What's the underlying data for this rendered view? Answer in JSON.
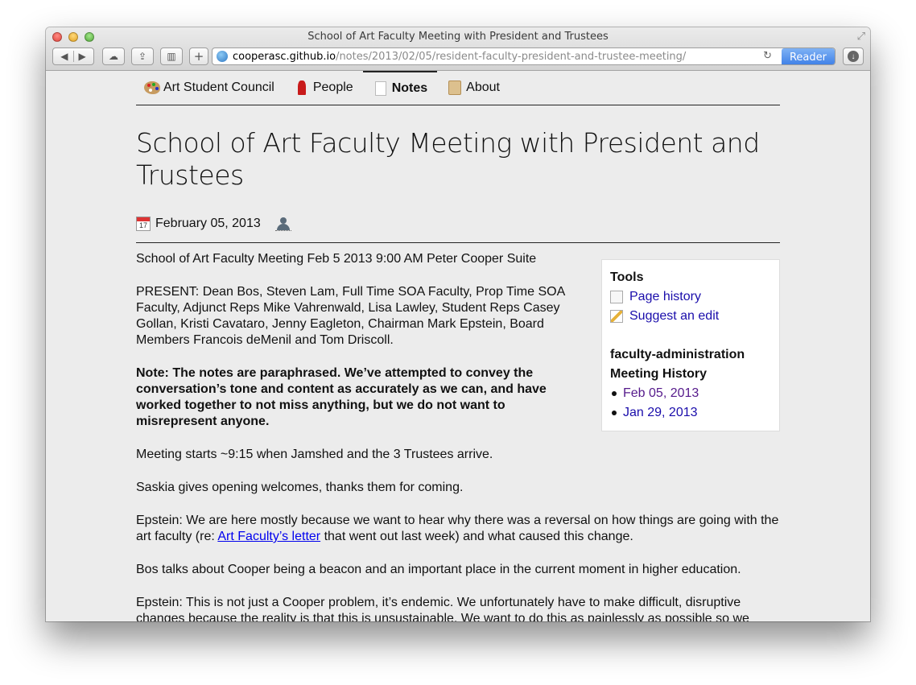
{
  "window": {
    "title": "School of Art Faculty Meeting with President and Trustees",
    "url_host": "cooperasc.github.io",
    "url_path": "/notes/2013/02/05/resident-faculty-president-and-trustee-meeting/",
    "reader_label": "Reader"
  },
  "nav": {
    "items": [
      {
        "label": "Art Student Council",
        "icon": "palette-icon"
      },
      {
        "label": "People",
        "icon": "dancer-icon"
      },
      {
        "label": "Notes",
        "icon": "document-icon",
        "active": true
      },
      {
        "label": "About",
        "icon": "scroll-icon"
      }
    ]
  },
  "post": {
    "title": "School of Art Faculty Meeting with President and Trustees",
    "date": "February 05, 2013",
    "calendar_day": "17",
    "paragraphs": {
      "p1": "School of Art Faculty Meeting Feb 5 2013 9:00 AM Peter Cooper Suite",
      "p2": "PRESENT: Dean Bos, Steven Lam, Full Time SOA Faculty, Prop Time SOA Faculty, Adjunct Reps Mike Vahrenwald, Lisa Lawley, Student Reps Casey Gollan, Kristi Cavataro, Jenny Eagleton, Chairman Mark Epstein, Board Members Francois deMenil and Tom Driscoll.",
      "note": "Note: The notes are paraphrased. We’ve attempted to convey the conversation’s tone and content as accurately as we can, and have worked together to not miss anything, but we do not want to misrepresent anyone.",
      "p3": "Meeting starts ~9:15 when Jamshed and the 3 Trustees arrive.",
      "p4": "Saskia gives opening welcomes, thanks them for coming.",
      "p5_before": "Epstein: We are here mostly because we want to hear why there was a reversal on how things are going with the art faculty (re: ",
      "p5_link": "Art Faculty’s letter",
      "p5_after": " that went out last week) and what caused this change.",
      "p6": "Bos talks about Cooper being a beacon and an important place in the current moment in higher education.",
      "p7": "Epstein: This is not just a Cooper problem, it’s endemic. We unfortunately have to make difficult, disruptive changes because the reality is that this is unsustainable. We want to do this as painlessly as possible so we"
    }
  },
  "tools": {
    "heading": "Tools",
    "page_history": "Page history",
    "suggest_edit": "Suggest an edit",
    "category": "faculty-administration",
    "history_heading": "Meeting History",
    "history": [
      "Feb 05, 2013",
      "Jan 29, 2013"
    ]
  }
}
